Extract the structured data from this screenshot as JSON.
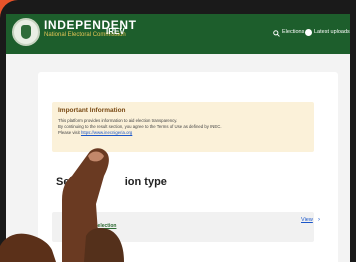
{
  "header": {
    "brand": "INDEPENDENT",
    "brand_sub": "National Electoral Commission",
    "app_name": "IREV",
    "nav": {
      "elections_label": "Elections",
      "uploads_label": "Latest uploads"
    }
  },
  "notice": {
    "title": "Important Information",
    "line1": "This platform provides information to aid election transparency.",
    "line2": "By continuing to the result section, you agree to the Terms of Use as defined by INEC.",
    "line3_prefix": "Please visit",
    "link": "https://www.inecnigeria.org"
  },
  "main": {
    "section_title_start": "Selec",
    "section_title_end": "ion type",
    "election_item_label": "al election",
    "view_label": "View"
  },
  "icons": {
    "search": "search-icon",
    "info": "info-icon",
    "chevron": "chevron-right-icon",
    "logo": "logo-icon"
  },
  "colors": {
    "background": "#e8532a",
    "header_green": "#1d5e2c",
    "notice_bg": "#fbf1d9",
    "link_blue": "#1a56c9"
  }
}
